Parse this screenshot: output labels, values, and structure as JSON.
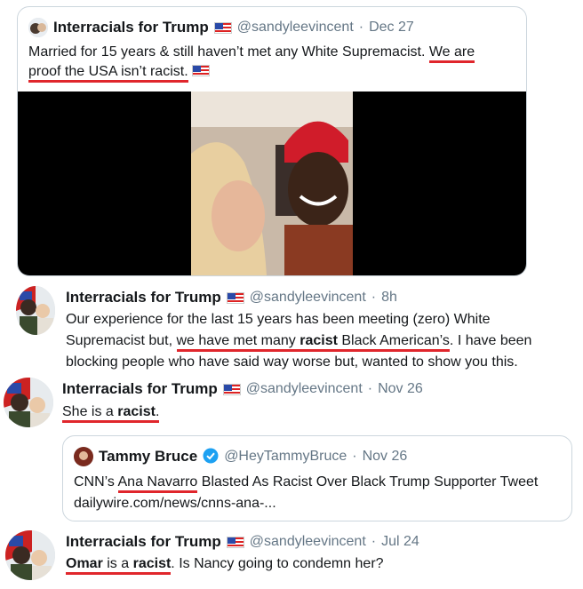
{
  "tweet1": {
    "name": "Interracials for Trump",
    "handle": "@sandyleevincent",
    "dot": "·",
    "date": "Dec 27",
    "text_a": "Married for 15 years & still haven’t met any White Supremacist.",
    "text_b_ul1": "We are",
    "text_b_ul2": "proof the USA isn’t racist."
  },
  "tweet2": {
    "name": "Interracials for Trump",
    "handle": "@sandyleevincent",
    "dot": "·",
    "date": "8h",
    "line1": "Our experience for the last 15 years has been meeting (zero) White",
    "line2_pre": "Supremacist but, ",
    "line2_ul_a": "we have met many ",
    "line2_ul_b": "racist",
    "line2_ul_c": " Black American’s",
    "line2_post": ". I have been",
    "line3": "blocking people who have said way worse but, wanted to show you this."
  },
  "tweet3": {
    "name": "Interracials for Trump",
    "handle": "@sandyleevincent",
    "dot": "·",
    "date": "Nov 26",
    "text_a": "She is a ",
    "text_b": "racist",
    "text_c": ".",
    "quote": {
      "name": "Tammy Bruce",
      "handle": "@HeyTammyBruce",
      "dot": "·",
      "date": "Nov 26",
      "line1_a": "CNN’s ",
      "line1_ul": "Ana Navarro",
      "line1_b": " Blasted As Racist Over Black Trump Supporter Tweet",
      "line2": "dailywire.com/news/cnns-ana-..."
    }
  },
  "tweet4": {
    "name": "Interracials for Trump",
    "handle": "@sandyleevincent",
    "dot": "·",
    "date": "Jul 24",
    "text_a": "Omar",
    "text_b": " is a ",
    "text_c": "racist",
    "text_d": ". Is Nancy going to condemn her?"
  },
  "icons": {
    "flag": "us-flag-icon",
    "verified": "verified-badge-icon"
  },
  "colors": {
    "underline": "#e0262c",
    "verified": "#1da1f2",
    "secondary": "#657786"
  }
}
